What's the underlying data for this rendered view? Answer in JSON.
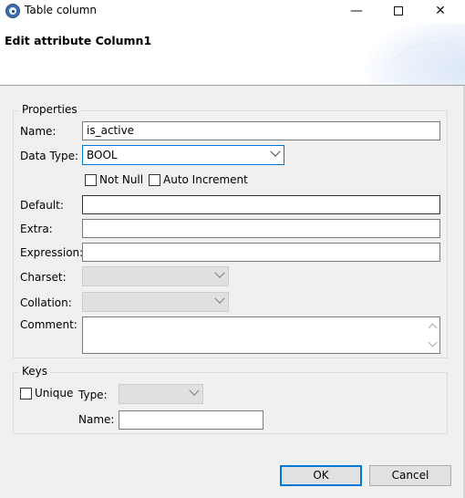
{
  "window": {
    "title": "Table column",
    "minimize_glyph": "—",
    "close_glyph": "✕"
  },
  "header": {
    "title": "Edit attribute Column1"
  },
  "properties": {
    "group_label": "Properties",
    "name_label": "Name:",
    "name_value": "is_active",
    "data_type_label": "Data Type:",
    "data_type_value": "BOOL",
    "not_null_label": "Not Null",
    "not_null_checked": false,
    "auto_increment_label": "Auto Increment",
    "auto_increment_checked": false,
    "default_label": "Default:",
    "default_value": "",
    "extra_label": "Extra:",
    "extra_value": "",
    "expression_label": "Expression:",
    "expression_value": "",
    "charset_label": "Charset:",
    "charset_value": "",
    "collation_label": "Collation:",
    "collation_value": "",
    "comment_label": "Comment:",
    "comment_value": ""
  },
  "keys": {
    "group_label": "Keys",
    "unique_label": "Unique",
    "unique_checked": false,
    "type_label": "Type:",
    "type_value": "",
    "name_label": "Name:",
    "name_value": ""
  },
  "buttons": {
    "ok_label": "OK",
    "cancel_label": "Cancel"
  },
  "icons": {
    "app": "app-icon",
    "dropdown": "chevron-down-icon"
  },
  "colors": {
    "focus_border": "#0078d7",
    "dialog_background": "#f0f0f0"
  }
}
